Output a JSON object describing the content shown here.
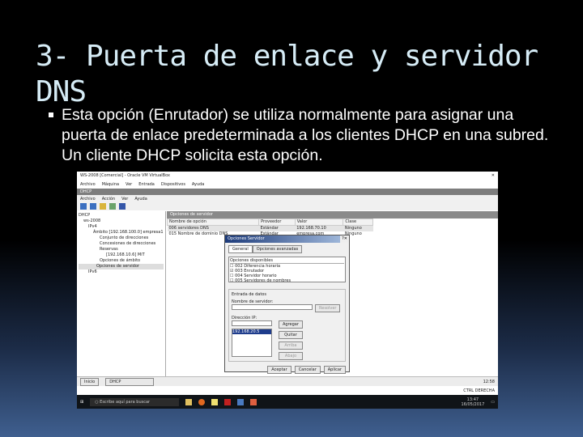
{
  "slide": {
    "title": "3- Puerta de enlace y servidor DNS",
    "bullet": "Esta opción (Enrutador) se utiliza normalmente para asignar una puerta de enlace predeterminada a los clientes DHCP en una subred. Un cliente DHCP solicita esta opción."
  },
  "vm": {
    "title": "WS-2008 [Comercial] - Oracle VM VirtualBox",
    "menu": [
      "Archivo",
      "Máquina",
      "Ver",
      "Entrada",
      "Dispositivos",
      "Ayuda"
    ]
  },
  "mmc": {
    "title": "DHCP",
    "menu": [
      "Archivo",
      "Acción",
      "Ver",
      "Ayuda"
    ],
    "tree": [
      "DHCP",
      "ws-2008",
      "IPv4",
      "Ámbito [192.168.100.0] empresa1",
      "Conjunto de direcciones",
      "Concesiones de direcciones",
      "Reservas",
      "[192.168.10.6] MiT",
      "Opciones de ámbito",
      "Opciones de servidor",
      "IPv6"
    ],
    "pane_title": "Opciones de servidor",
    "columns": [
      "Nombre de opción",
      "Proveedor",
      "Valor",
      "Clase"
    ],
    "rows": [
      [
        "006 servidores DNS",
        "Estándar",
        "192.168.70.10",
        "Ninguno"
      ],
      [
        "015 Nombre de dominio DNS",
        "Estándar",
        "empresa.com",
        "Ninguno"
      ]
    ]
  },
  "dialog": {
    "title": "Opciones Servidor",
    "tabs": [
      "General",
      "Opciones avanzadas"
    ],
    "list_header": "Opciones disponibles",
    "options": [
      {
        "label": "002 Diferencia horaria",
        "checked": false
      },
      {
        "label": "003 Enrutador",
        "checked": true
      },
      {
        "label": "004 Servidor horario",
        "checked": false
      },
      {
        "label": "005 Servidores de nombres",
        "checked": false
      }
    ],
    "group": "Entrada de datos",
    "server_label": "Nombre de servidor:",
    "resolve": "Resolver",
    "ip_label": "Dirección IP:",
    "ip_value": "192.168.20.5",
    "side_buttons": [
      "Agregar",
      "Quitar",
      "Arriba",
      "Abajo"
    ],
    "buttons": [
      "Aceptar",
      "Cancelar",
      "Aplicar"
    ]
  },
  "status": {
    "start": "Inicio",
    "task": "DHCP",
    "ctrl": "CTRL DERECHA",
    "clock": "12:58"
  },
  "taskbar": {
    "search": "Escribe aquí para buscar",
    "time": "13:47",
    "date": "16/05/2017"
  }
}
